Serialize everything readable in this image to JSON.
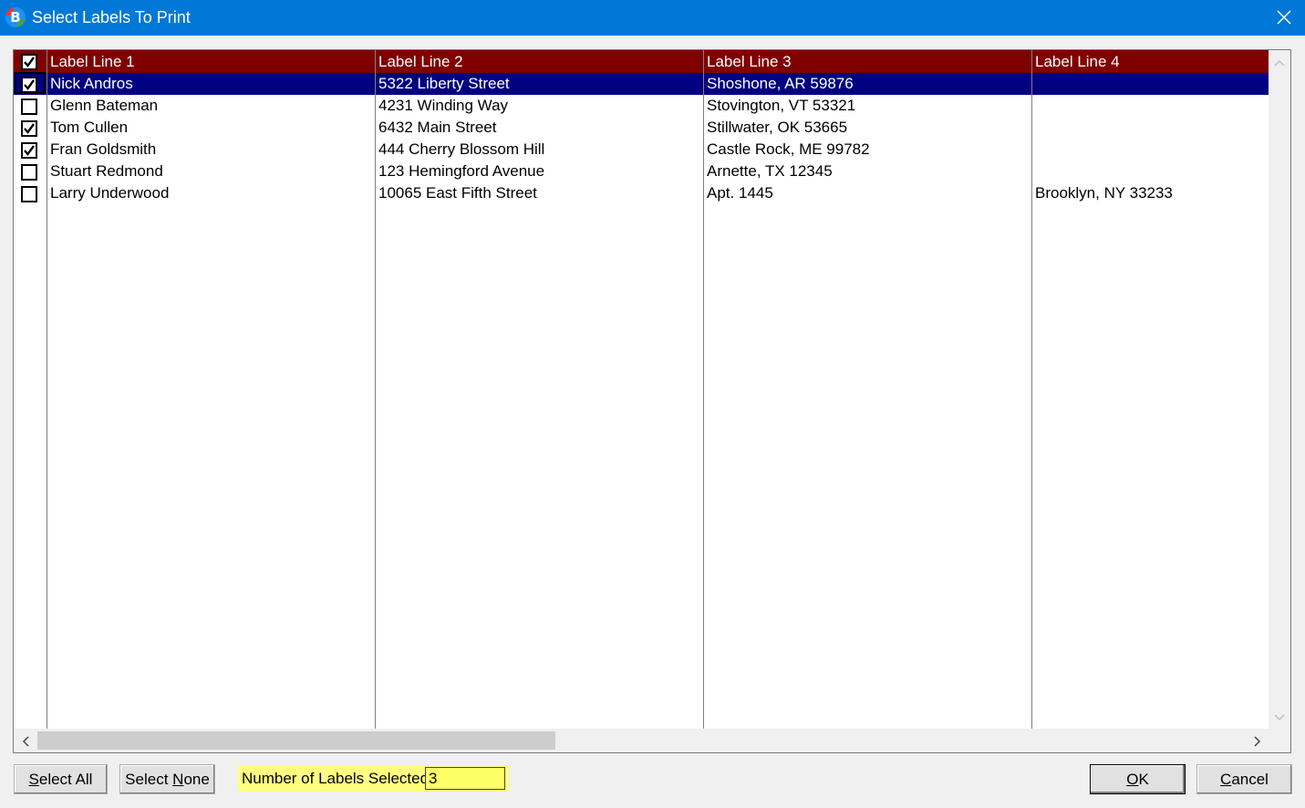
{
  "window": {
    "title": "Select Labels To Print",
    "icon": "app-b-icon"
  },
  "grid": {
    "columns": [
      "Label Line 1",
      "Label Line 2",
      "Label Line 3",
      "Label Line 4"
    ],
    "header_checked": true,
    "rows": [
      {
        "checked": true,
        "selected": true,
        "cells": [
          "Nick Andros",
          "5322 Liberty Street",
          "Shoshone, AR  59876",
          ""
        ]
      },
      {
        "checked": false,
        "selected": false,
        "cells": [
          "Glenn Bateman",
          "4231 Winding Way",
          "Stovington, VT  53321",
          ""
        ]
      },
      {
        "checked": true,
        "selected": false,
        "cells": [
          "Tom Cullen",
          "6432 Main Street",
          "Stillwater, OK  53665",
          ""
        ]
      },
      {
        "checked": true,
        "selected": false,
        "cells": [
          "Fran Goldsmith",
          "444 Cherry Blossom Hill",
          "Castle Rock, ME  99782",
          ""
        ]
      },
      {
        "checked": false,
        "selected": false,
        "cells": [
          "Stuart Redmond",
          "123 Hemingford Avenue",
          "Arnette, TX  12345",
          ""
        ]
      },
      {
        "checked": false,
        "selected": false,
        "cells": [
          "Larry Underwood",
          "10065 East Fifth Street",
          "Apt. 1445",
          "Brooklyn, NY  33233"
        ]
      }
    ]
  },
  "footer": {
    "select_all_prefix": "S",
    "select_all_rest": "elect All",
    "select_none_prefix": "Select ",
    "select_none_u": "N",
    "select_none_rest": "one",
    "count_label": "Number of Labels Selected:",
    "count_value": "3",
    "ok_u": "O",
    "ok_rest": "K",
    "cancel_u": "C",
    "cancel_rest": "ancel"
  },
  "colors": {
    "header_bg": "#800000",
    "selected_row_bg": "#000080",
    "titlebar": "#0078d7",
    "count_highlight": "#ffff80"
  }
}
